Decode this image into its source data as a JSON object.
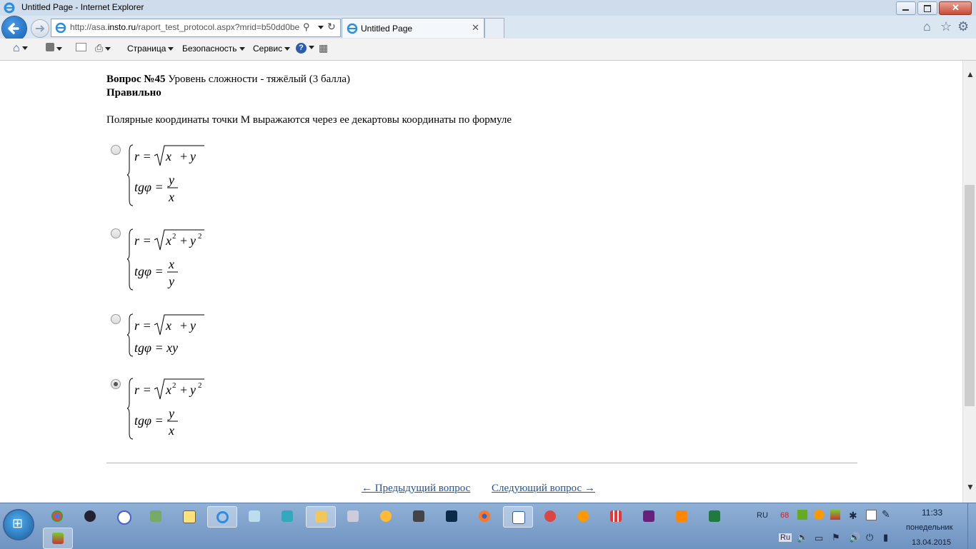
{
  "window": {
    "title": "Untitled Page - Internet Explorer"
  },
  "navbar": {
    "url_prefix": "http://asa.",
    "url_domain": "insto.ru",
    "url_rest": "/raport_test_protocol.aspx?mrid=b50dd0be",
    "tab_label": "Untitled Page"
  },
  "cmdbar": {
    "page_label": "Страница",
    "security_label": "Безопасность",
    "service_label": "Сервис"
  },
  "question": {
    "number": "Вопрос №45",
    "difficulty": " Уровень сложности - тяжёлый (3 балла)",
    "status": "Правильно",
    "text": "Полярные координаты точки М выражаются через ее декартовы координаты по формуле",
    "options": [
      {
        "line1_lhs": "r =",
        "line1_rad": "x  + y",
        "line2_lhs": "tgφ =",
        "line2_num": "y",
        "line2_den": "x",
        "squared": false,
        "checked": false
      },
      {
        "line1_lhs": "r =",
        "line1_rad": "x² + y²",
        "line2_lhs": "tgφ =",
        "line2_num": "x",
        "line2_den": "y",
        "squared": true,
        "checked": false
      },
      {
        "line1_lhs": "r =",
        "line1_rad": "x  + y",
        "line2_lhs": "tgφ = xy",
        "squared": false,
        "checked": false
      },
      {
        "line1_lhs": "r =",
        "line1_rad": "x² + y²",
        "line2_lhs": "tgφ =",
        "line2_num": "y",
        "line2_den": "x",
        "squared": true,
        "checked": true
      }
    ]
  },
  "navigation": {
    "prev": "← Предыдущий вопрос",
    "next": "Следующий вопрос →"
  },
  "tray": {
    "lang": "RU",
    "badge": "68",
    "lang2": "Ru",
    "time": "11:33",
    "day": "понедельник",
    "date": "13.04.2015"
  }
}
